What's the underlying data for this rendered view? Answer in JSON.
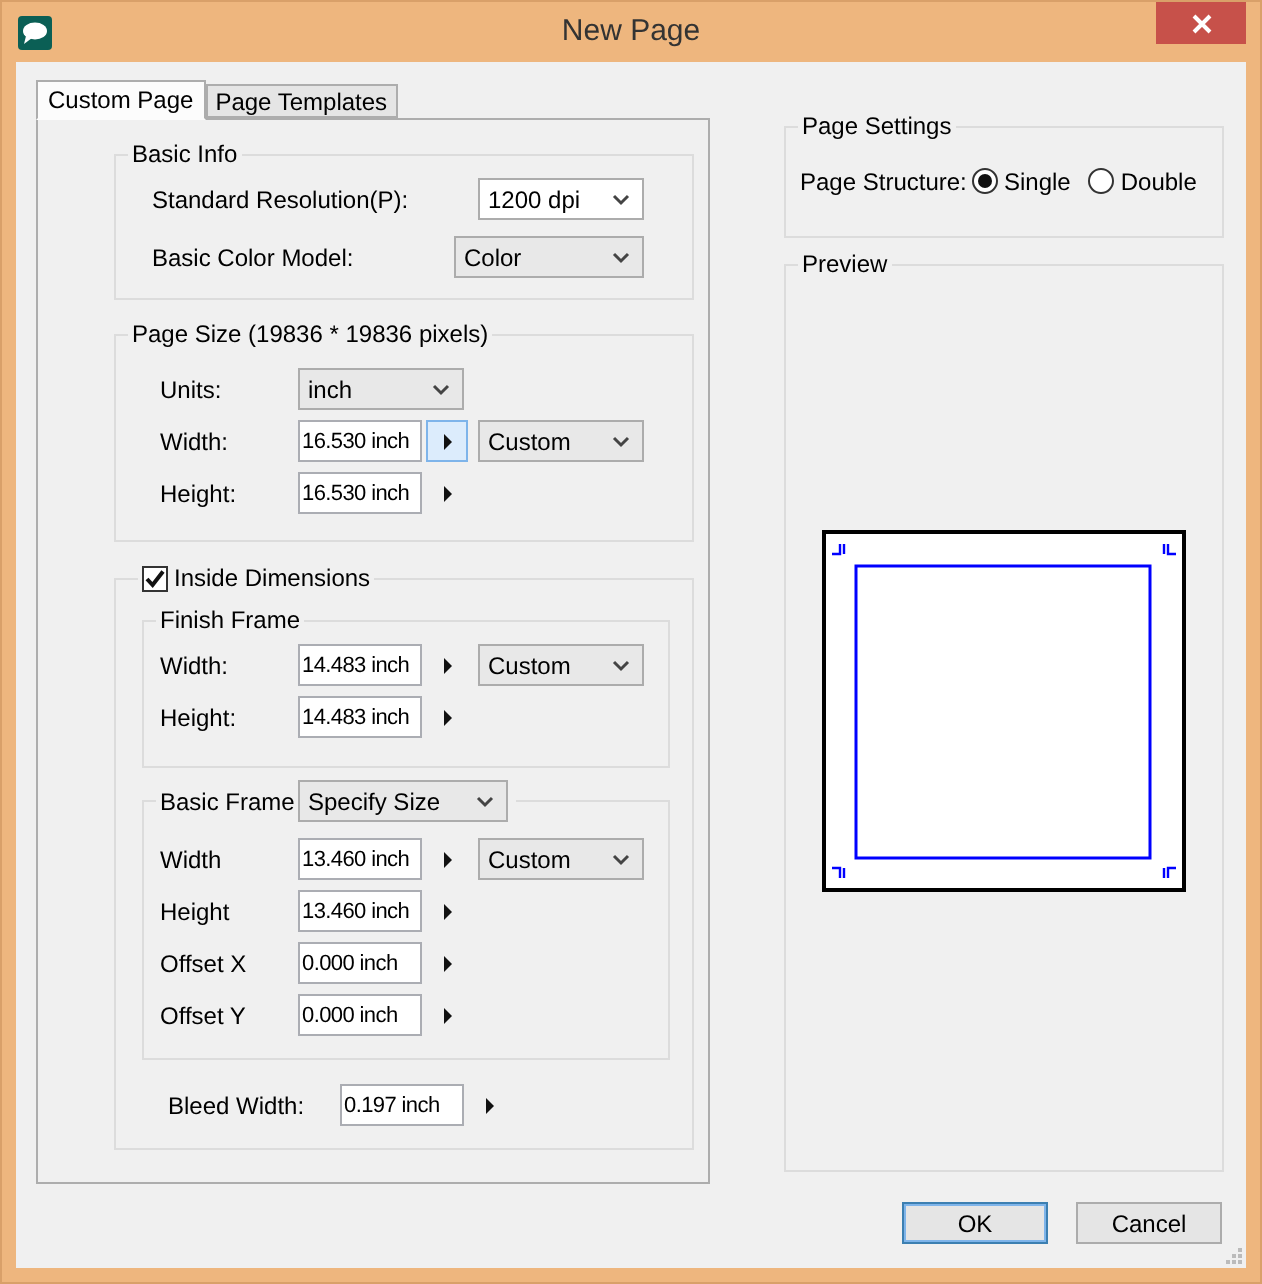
{
  "window": {
    "title": "New Page"
  },
  "tabs": [
    {
      "label": "Custom Page",
      "selected": true
    },
    {
      "label": "Page Templates",
      "selected": false
    }
  ],
  "basic_info": {
    "title": "Basic Info",
    "rows": [
      {
        "label": "Standard Resolution(P):",
        "value": "1200 dpi",
        "kind": "combo"
      },
      {
        "label": "Basic Color Model:",
        "value": "Color",
        "kind": "list"
      }
    ]
  },
  "page_size": {
    "title": "Page Size (19836 * 19836 pixels)",
    "units": {
      "label": "Units:",
      "value": "inch"
    },
    "rows": [
      {
        "label": "Width:",
        "value": "16.530 inch",
        "highlighted": true,
        "preset": "Custom"
      },
      {
        "label": "Height:",
        "value": "16.530 inch",
        "highlighted": false
      }
    ]
  },
  "inside_dimensions": {
    "label": "Inside Dimensions",
    "checked": true,
    "finish_frame": {
      "title": "Finish Frame",
      "rows": [
        {
          "label": "Width:",
          "value": "14.483 inch",
          "highlighted": false,
          "preset": "Custom"
        },
        {
          "label": "Height:",
          "value": "14.483 inch",
          "highlighted": false
        }
      ]
    },
    "basic_frame": {
      "title": "Basic Frame",
      "mode": "Specify Size",
      "rows": [
        {
          "label": "Width",
          "value": "13.460 inch",
          "highlighted": false,
          "preset": "Custom"
        },
        {
          "label": "Height",
          "value": "13.460 inch",
          "highlighted": false
        },
        {
          "label": "Offset X",
          "value": "0.000 inch",
          "highlighted": false
        },
        {
          "label": "Offset Y",
          "value": "0.000 inch",
          "highlighted": false
        }
      ]
    },
    "bleed": {
      "label": "Bleed Width:",
      "value": "0.197 inch",
      "highlighted": false
    }
  },
  "page_settings": {
    "title": "Page Settings",
    "label": "Page Structure:",
    "options": [
      {
        "label": "Single",
        "selected": true
      },
      {
        "label": "Double",
        "selected": false
      }
    ]
  },
  "preview": {
    "title": "Preview"
  },
  "buttons": [
    {
      "label": "OK",
      "kind": "default"
    },
    {
      "label": "Cancel",
      "kind": "normal"
    }
  ]
}
